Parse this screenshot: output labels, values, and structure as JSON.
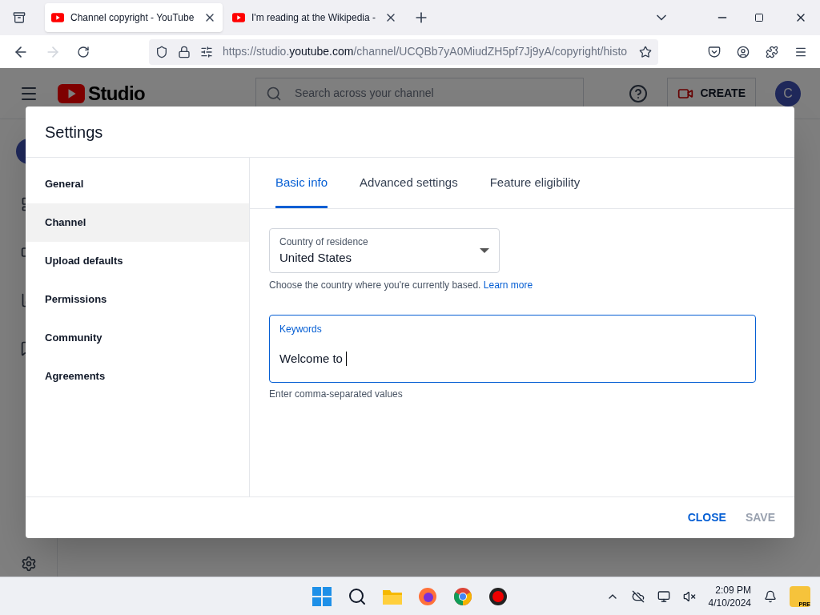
{
  "browser": {
    "tabs": [
      {
        "title": "Channel copyright - YouTube",
        "selected": true
      },
      {
        "title": "I'm reading at the Wikipedia -",
        "selected": false
      }
    ],
    "url": {
      "prefix": "https://studio.",
      "domain": "youtube.com",
      "path": "/channel/UCQBb7yA0MiudZH5pf7Jj9yA/copyright/histo"
    }
  },
  "studio": {
    "logo": "Studio",
    "search": {
      "placeholder": "Search across your channel"
    },
    "create_button": "CREATE",
    "avatar": "C"
  },
  "dialog": {
    "title": "Settings",
    "nav": [
      {
        "label": "General",
        "selected": false
      },
      {
        "label": "Channel",
        "selected": true
      },
      {
        "label": "Upload defaults",
        "selected": false
      },
      {
        "label": "Permissions",
        "selected": false
      },
      {
        "label": "Community",
        "selected": false
      },
      {
        "label": "Agreements",
        "selected": false
      }
    ],
    "tabs": [
      {
        "label": "Basic info",
        "selected": true
      },
      {
        "label": "Advanced settings",
        "selected": false
      },
      {
        "label": "Feature eligibility",
        "selected": false
      }
    ],
    "country": {
      "label": "Country of residence",
      "value": "United States",
      "help": "Choose the country where you're currently based.",
      "link": "Learn more"
    },
    "keywords": {
      "label": "Keywords",
      "value": "Welcome to ",
      "focused": true,
      "help": "Enter comma-separated values"
    },
    "buttons": [
      {
        "label": "CLOSE",
        "disabled": false
      },
      {
        "label": "SAVE",
        "disabled": true
      }
    ]
  },
  "taskbar": {
    "time": "2:09 PM",
    "date": "4/10/2024",
    "badge": "PRE"
  }
}
